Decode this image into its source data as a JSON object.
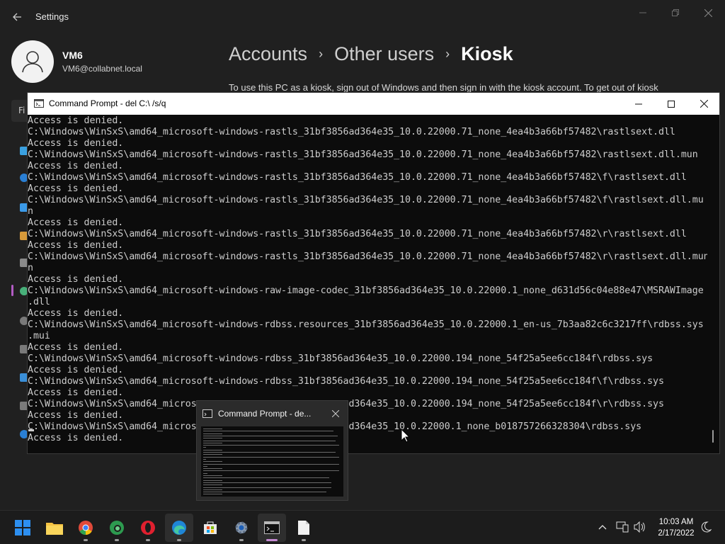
{
  "settings": {
    "app_title": "Settings",
    "user": {
      "name": "VM6",
      "email": "VM6@collabnet.local"
    },
    "breadcrumb": [
      "Accounts",
      "Other users",
      "Kiosk"
    ],
    "description": "To use this PC as a kiosk, sign out of Windows and then sign in with the kiosk account. To get out of kiosk",
    "find_placeholder": "Fi"
  },
  "cmd": {
    "title": "Command Prompt - del  C:\\ /s/q",
    "lines": [
      "Access is denied.",
      "C:\\Windows\\WinSxS\\amd64_microsoft-windows-rastls_31bf3856ad364e35_10.0.22000.71_none_4ea4b3a66bf57482\\rastlsext.dll",
      "Access is denied.",
      "C:\\Windows\\WinSxS\\amd64_microsoft-windows-rastls_31bf3856ad364e35_10.0.22000.71_none_4ea4b3a66bf57482\\rastlsext.dll.mun",
      "Access is denied.",
      "C:\\Windows\\WinSxS\\amd64_microsoft-windows-rastls_31bf3856ad364e35_10.0.22000.71_none_4ea4b3a66bf57482\\f\\rastlsext.dll",
      "Access is denied.",
      "C:\\Windows\\WinSxS\\amd64_microsoft-windows-rastls_31bf3856ad364e35_10.0.22000.71_none_4ea4b3a66bf57482\\f\\rastlsext.dll.mu",
      "n",
      "Access is denied.",
      "C:\\Windows\\WinSxS\\amd64_microsoft-windows-rastls_31bf3856ad364e35_10.0.22000.71_none_4ea4b3a66bf57482\\r\\rastlsext.dll",
      "Access is denied.",
      "C:\\Windows\\WinSxS\\amd64_microsoft-windows-rastls_31bf3856ad364e35_10.0.22000.71_none_4ea4b3a66bf57482\\r\\rastlsext.dll.mun",
      "n",
      "Access is denied.",
      "C:\\Windows\\WinSxS\\amd64_microsoft-windows-raw-image-codec_31bf3856ad364e35_10.0.22000.1_none_d631d56c04e88e47\\MSRAWImage",
      ".dll",
      "Access is denied.",
      "C:\\Windows\\WinSxS\\amd64_microsoft-windows-rdbss.resources_31bf3856ad364e35_10.0.22000.1_en-us_7b3aa82c6c3217ff\\rdbss.sys",
      ".mui",
      "Access is denied.",
      "C:\\Windows\\WinSxS\\amd64_microsoft-windows-rdbss_31bf3856ad364e35_10.0.22000.194_none_54f25a5ee6cc184f\\rdbss.sys",
      "Access is denied.",
      "C:\\Windows\\WinSxS\\amd64_microsoft-windows-rdbss_31bf3856ad364e35_10.0.22000.194_none_54f25a5ee6cc184f\\f\\rdbss.sys",
      "Access is denied.",
      "C:\\Windows\\WinSxS\\amd64_micros                           d364e35_10.0.22000.194_none_54f25a5ee6cc184f\\r\\rdbss.sys",
      "Access is denied.",
      "C:\\Windows\\WinSxS\\amd64_micros                           d364e35_10.0.22000.1_none_b018757266328304\\rdbss.sys",
      "Access is denied."
    ]
  },
  "preview": {
    "title": "Command Prompt - de..."
  },
  "taskbar": {
    "apps": [
      "start-icon",
      "file-explorer-icon",
      "chrome-icon",
      "edge-beta-icon",
      "opera-icon",
      "edge-icon",
      "store-icon",
      "settings-icon",
      "cmd-icon",
      "notepad-icon"
    ],
    "time": "10:03 AM",
    "date": "2/17/2022"
  },
  "colors": {
    "accent": "#b25bc4",
    "console_bg": "#0c0c0c",
    "console_text": "#cccccc",
    "window_bg": "#202020"
  }
}
